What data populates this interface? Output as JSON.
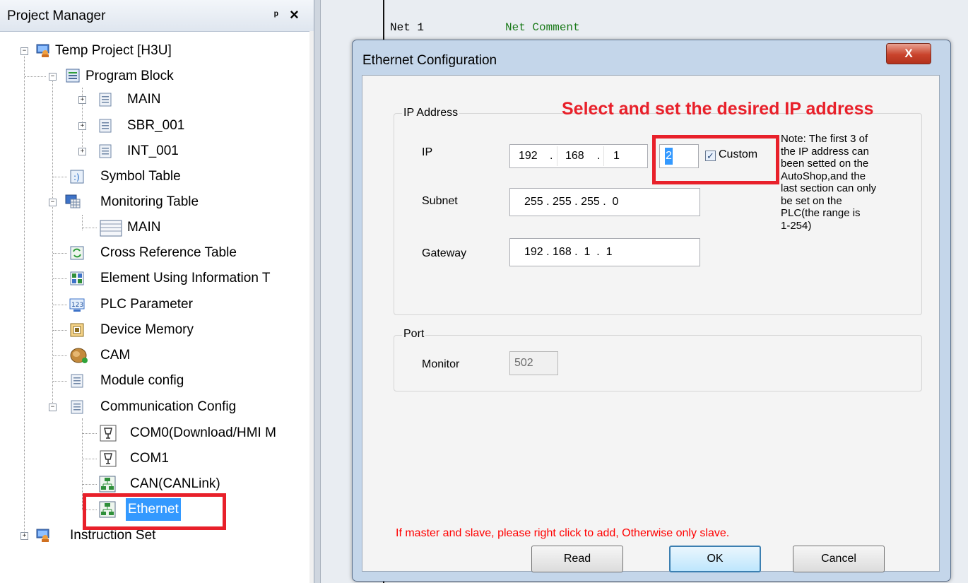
{
  "project_manager": {
    "title": "Project Manager",
    "pin_glyph": "ᵖ",
    "close_glyph": "×",
    "items": [
      {
        "label": "Temp Project [H3U]",
        "icon": "project-icon"
      },
      {
        "label": "Program Block",
        "icon": "program-block-icon"
      },
      {
        "label": "MAIN",
        "icon": "document-icon"
      },
      {
        "label": "SBR_001",
        "icon": "document-icon"
      },
      {
        "label": "INT_001",
        "icon": "document-icon"
      },
      {
        "label": "Symbol Table",
        "icon": "symbol-table-icon"
      },
      {
        "label": "Monitoring Table",
        "icon": "monitoring-table-icon"
      },
      {
        "label": "MAIN",
        "icon": "table-icon"
      },
      {
        "label": "Cross Reference Table",
        "icon": "cross-reference-icon"
      },
      {
        "label": "Element Using Information T",
        "icon": "grid-icon"
      },
      {
        "label": "PLC Parameter",
        "icon": "plc-parameter-icon"
      },
      {
        "label": "Device Memory",
        "icon": "device-memory-icon"
      },
      {
        "label": "CAM",
        "icon": "cam-icon"
      },
      {
        "label": "Module config",
        "icon": "document-icon"
      },
      {
        "label": "Communication Config",
        "icon": "document-icon"
      },
      {
        "label": "COM0(Download/HMI M",
        "icon": "serial-port-icon"
      },
      {
        "label": "COM1",
        "icon": "serial-port-icon"
      },
      {
        "label": "CAN(CANLink)",
        "icon": "network-icon"
      },
      {
        "label": "Ethernet",
        "icon": "network-icon"
      },
      {
        "label": "Instruction Set",
        "icon": "project-icon"
      }
    ]
  },
  "editor": {
    "net_label": "Net 1",
    "net_comment": "Net Comment"
  },
  "dialog": {
    "title": "Ethernet Configuration",
    "close_label": "X",
    "annotation": "Select and set the desired IP address",
    "ip_group": {
      "title": "IP Address",
      "ip_label": "IP",
      "ip": [
        "192",
        "168",
        "1",
        "2"
      ],
      "dot": ".",
      "custom_label": "Custom",
      "custom_checked": true,
      "subnet_label": "Subnet",
      "subnet": "255 . 255 . 255 .  0",
      "gateway_label": "Gateway",
      "gateway": "192 . 168 .  1  .  1",
      "note": [
        "Note: The first 3 of",
        "the IP address can",
        "been setted on the",
        "AutoShop,and the",
        "last section can only",
        "be set on the",
        "PLC(the range is",
        "1-254)"
      ]
    },
    "port_group": {
      "title": "Port",
      "monitor_label": "Monitor",
      "monitor_value": "502"
    },
    "hint": "If master and slave, please right click to add, Otherwise only slave.",
    "buttons": {
      "read": "Read",
      "ok": "OK",
      "cancel": "Cancel"
    }
  },
  "colors": {
    "highlight_red": "#e8202a",
    "selection_blue": "#3399ff",
    "hint_red": "#ff0000"
  }
}
